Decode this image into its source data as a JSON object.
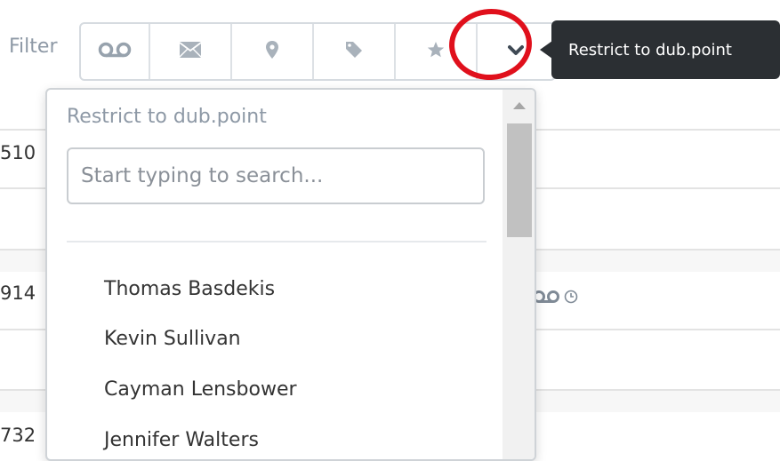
{
  "filter": {
    "label": "Filter",
    "buttons": [
      {
        "name": "voicemail-icon"
      },
      {
        "name": "envelope-icon"
      },
      {
        "name": "map-marker-icon"
      },
      {
        "name": "tag-icon"
      },
      {
        "name": "star-icon"
      },
      {
        "name": "chevron-down-icon"
      }
    ],
    "highlight_color": "#e0101c"
  },
  "tooltip": {
    "text": "Restrict to dub.point"
  },
  "dropdown": {
    "header": "Restrict to dub.point",
    "search_placeholder": "Start typing to search...",
    "items": [
      "Thomas Basdekis",
      "Kevin Sullivan",
      "Cayman Lensbower",
      "Jennifer Walters"
    ]
  },
  "background_rows": [
    {
      "number": "510"
    },
    {
      "number": "914",
      "trailing": ")"
    },
    {
      "number": "732"
    }
  ]
}
